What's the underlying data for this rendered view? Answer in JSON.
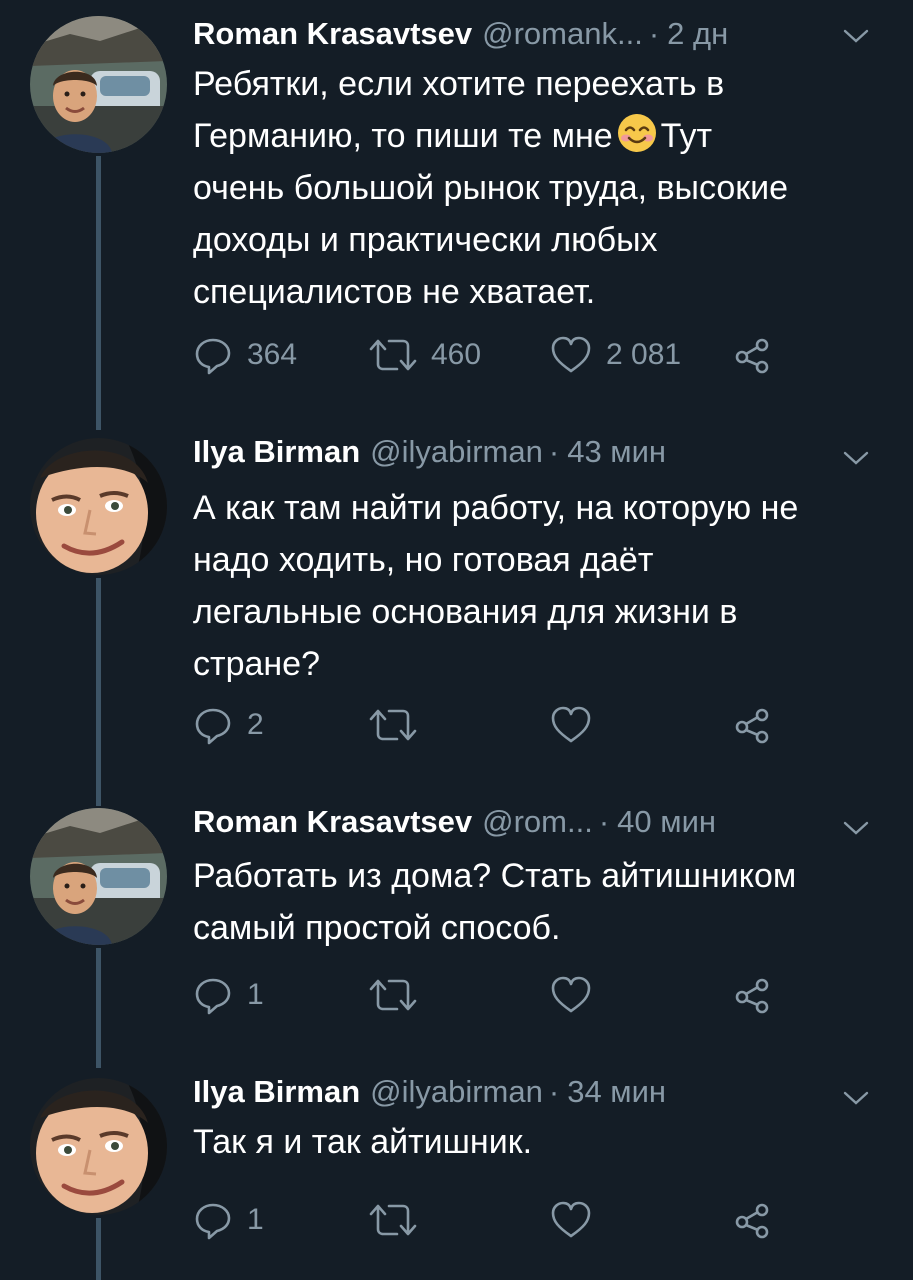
{
  "colors": {
    "background": "#141d26",
    "text": "#ffffff",
    "secondary": "#8899a6",
    "thread_line": "#3d5466"
  },
  "tweets": [
    {
      "name": "Roman Krasavtsev",
      "handle": "@romank...",
      "dot": "·",
      "time": "2 дн",
      "avatar": "roman-avatar",
      "lines": [
        "Ребятки, если хотите переехать в",
        "Германию, то пиши те мне",
        "Тут",
        "очень большой рынок труда, высокие",
        "доходы и практически любых",
        "специалистов не хватает."
      ],
      "emoji": "smiling-face-emoji",
      "reply_count": "364",
      "retweet_count": "460",
      "like_count": "2 081"
    },
    {
      "name": "Ilya Birman",
      "handle": "@ilyabirman",
      "dot": "·",
      "time": "43 мин",
      "avatar": "ilya-avatar",
      "lines": [
        "А как там найти работу, на которую не",
        "надо ходить, но готовая даёт",
        "легальные основания для жизни в",
        "стране?"
      ],
      "reply_count": "2",
      "retweet_count": "",
      "like_count": ""
    },
    {
      "name": "Roman Krasavtsev",
      "handle": "@rom...",
      "dot": "·",
      "time": "40 мин",
      "avatar": "roman-avatar",
      "lines": [
        "Работать из дома? Стать айтишником",
        "самый простой способ."
      ],
      "reply_count": "1",
      "retweet_count": "",
      "like_count": ""
    },
    {
      "name": "Ilya Birman",
      "handle": "@ilyabirman",
      "dot": "·",
      "time": "34 мин",
      "avatar": "ilya-avatar",
      "lines": [
        "Так я и так айтишник."
      ],
      "reply_count": "1",
      "retweet_count": "",
      "like_count": ""
    }
  ],
  "icons": {
    "reply": "reply-icon",
    "retweet": "retweet-icon",
    "like": "heart-icon",
    "share": "share-icon",
    "menu": "chevron-down-icon"
  }
}
